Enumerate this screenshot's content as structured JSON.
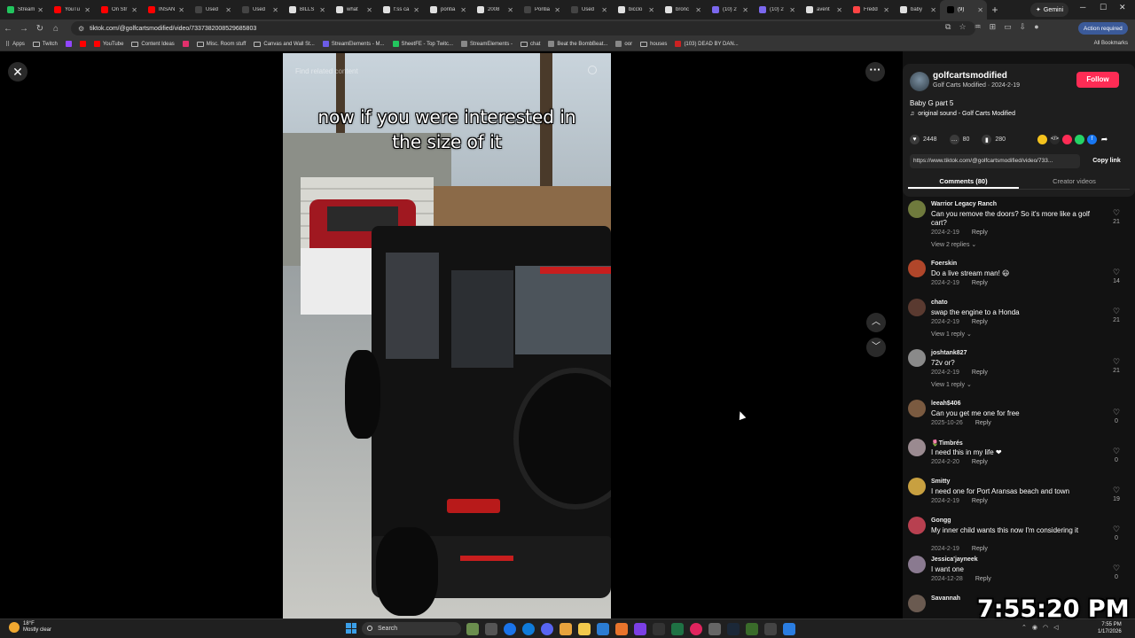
{
  "browser": {
    "tabs": [
      {
        "title": "Stream",
        "color": "#22c55e"
      },
      {
        "title": "YouTu",
        "color": "#ff0000"
      },
      {
        "title": "On Str",
        "color": "#ff0000"
      },
      {
        "title": "INSAN",
        "color": "#ff0000"
      },
      {
        "title": "Used",
        "color": "#444"
      },
      {
        "title": "Used",
        "color": "#444"
      },
      {
        "title": "BILLS",
        "color": "#e0e0e0"
      },
      {
        "title": "what",
        "color": "#e0e0e0"
      },
      {
        "title": "f:ss ca",
        "color": "#e0e0e0"
      },
      {
        "title": "pontia",
        "color": "#e0e0e0"
      },
      {
        "title": "2008",
        "color": "#e0e0e0"
      },
      {
        "title": "Pontia",
        "color": "#444"
      },
      {
        "title": "Used",
        "color": "#444"
      },
      {
        "title": "bicclo",
        "color": "#e0e0e0"
      },
      {
        "title": "bronc",
        "color": "#e0e0e0"
      },
      {
        "title": "(10) 2",
        "color": "#7b68ee"
      },
      {
        "title": "(10) 2",
        "color": "#7b68ee"
      },
      {
        "title": "avent",
        "color": "#e0e0e0"
      },
      {
        "title": "Fredd",
        "color": "#ff4444"
      },
      {
        "title": "baby",
        "color": "#e0e0e0"
      },
      {
        "title": "(9)",
        "color": "#000",
        "active": true
      }
    ],
    "gemini_label": "Gemini",
    "url": "tiktok.com/@golfcartsmodified/video/7337382008529685803",
    "action_required": "Action required",
    "bookmarks": [
      {
        "label": "Apps",
        "kind": "grid"
      },
      {
        "label": "Twitch",
        "kind": "folder"
      },
      {
        "label": "",
        "kind": "icon",
        "color": "#9146ff"
      },
      {
        "label": "",
        "kind": "icon",
        "color": "#ff0000"
      },
      {
        "label": "YouTube",
        "kind": "icon",
        "color": "#ff0000"
      },
      {
        "label": "Content Ideas",
        "kind": "folder"
      },
      {
        "label": "",
        "kind": "icon",
        "color": "#e1306c"
      },
      {
        "label": "Misc. Room stuff",
        "kind": "folder"
      },
      {
        "label": "Canvas and Wall St...",
        "kind": "folder"
      },
      {
        "label": "StreamElements - M...",
        "kind": "icon",
        "color": "#6c5ce7"
      },
      {
        "label": "SheetFE - Top Twitc...",
        "kind": "icon",
        "color": "#22c55e"
      },
      {
        "label": "StreamElements -",
        "kind": "icon",
        "color": "#888"
      },
      {
        "label": "chat",
        "kind": "folder"
      },
      {
        "label": "Beat the BombBeat...",
        "kind": "icon",
        "color": "#888"
      },
      {
        "label": "oor",
        "kind": "icon",
        "color": "#888"
      },
      {
        "label": "houses",
        "kind": "folder"
      },
      {
        "label": "(103) DEAD BY DAN...",
        "kind": "icon",
        "color": "#cc2222"
      }
    ],
    "all_bookmarks": "All Bookmarks"
  },
  "video": {
    "find_related": "Find related content",
    "caption_line1": "now if you were interested in",
    "caption_line2": "the size of it"
  },
  "panel": {
    "username": "golfcartsmodified",
    "display_name": "Golf Carts Modified",
    "separator": " · ",
    "post_date": "2024-2-19",
    "follow_label": "Follow",
    "description": "Baby G part 5",
    "sound": "original sound - Golf Carts Modified",
    "likes": "2448",
    "comments_count": "80",
    "saves": "280",
    "link": "https://www.tiktok.com/@golfcartsmodified/video/733...",
    "copy_link": "Copy link",
    "tab_comments": "Comments (80)",
    "tab_creator": "Creator videos"
  },
  "comments": [
    {
      "user": "Warrior Legacy Ranch",
      "text": "Can you remove the doors? So it's more like a golf cart?",
      "date": "2024-2-19",
      "likes": "21",
      "replies": "View 2 replies",
      "avatar_color": "#6f7a3d"
    },
    {
      "user": "Foerskin",
      "text": "Do a live stream man! 😃",
      "date": "2024-2-19",
      "likes": "14",
      "replies": "",
      "avatar_color": "#b0462a"
    },
    {
      "user": "chato",
      "text": "swap the engine to a Honda",
      "date": "2024-2-19",
      "likes": "21",
      "replies": "View 1 reply",
      "avatar_color": "#5a3a30"
    },
    {
      "user": "joshtank827",
      "text": "72v or?",
      "date": "2024-2-19",
      "likes": "21",
      "replies": "View 1 reply",
      "avatar_color": "#8a8a8a"
    },
    {
      "user": "leeah$406",
      "text": "Can you get me one for free",
      "date": "2025-10-26",
      "likes": "0",
      "replies": "",
      "avatar_color": "#7a5a40"
    },
    {
      "user": "🌷Timbrés",
      "text": "I need this in my life ❤",
      "date": "2024-2-20",
      "likes": "0",
      "replies": "",
      "avatar_color": "#9a8a90"
    },
    {
      "user": "Smitty",
      "text": "I need one for Port Aransas beach and town",
      "date": "2024-2-19",
      "likes": "19",
      "replies": "",
      "avatar_color": "#c8a040"
    },
    {
      "user": "Gongg",
      "text": "My inner child wants this now I'm considering it",
      "date": "2024-2-19",
      "likes": "0",
      "replies": "",
      "avatar_color": "#b84050"
    },
    {
      "user": "Jessica'jayneek",
      "text": "I want one",
      "date": "2024-12-28",
      "likes": "0",
      "replies": "",
      "avatar_color": "#8a7a90"
    },
    {
      "user": "Savannah",
      "text": "",
      "date": "",
      "likes": "",
      "replies": "",
      "avatar_color": "#6a5a50"
    }
  ],
  "reply_label": "Reply",
  "taskbar": {
    "weather_temp": "18°F",
    "weather_desc": "Mostly clear",
    "search_placeholder": "Search",
    "time": "7:55 PM",
    "date": "1/17/2026"
  },
  "overlay_clock": "7:55:20 PM"
}
